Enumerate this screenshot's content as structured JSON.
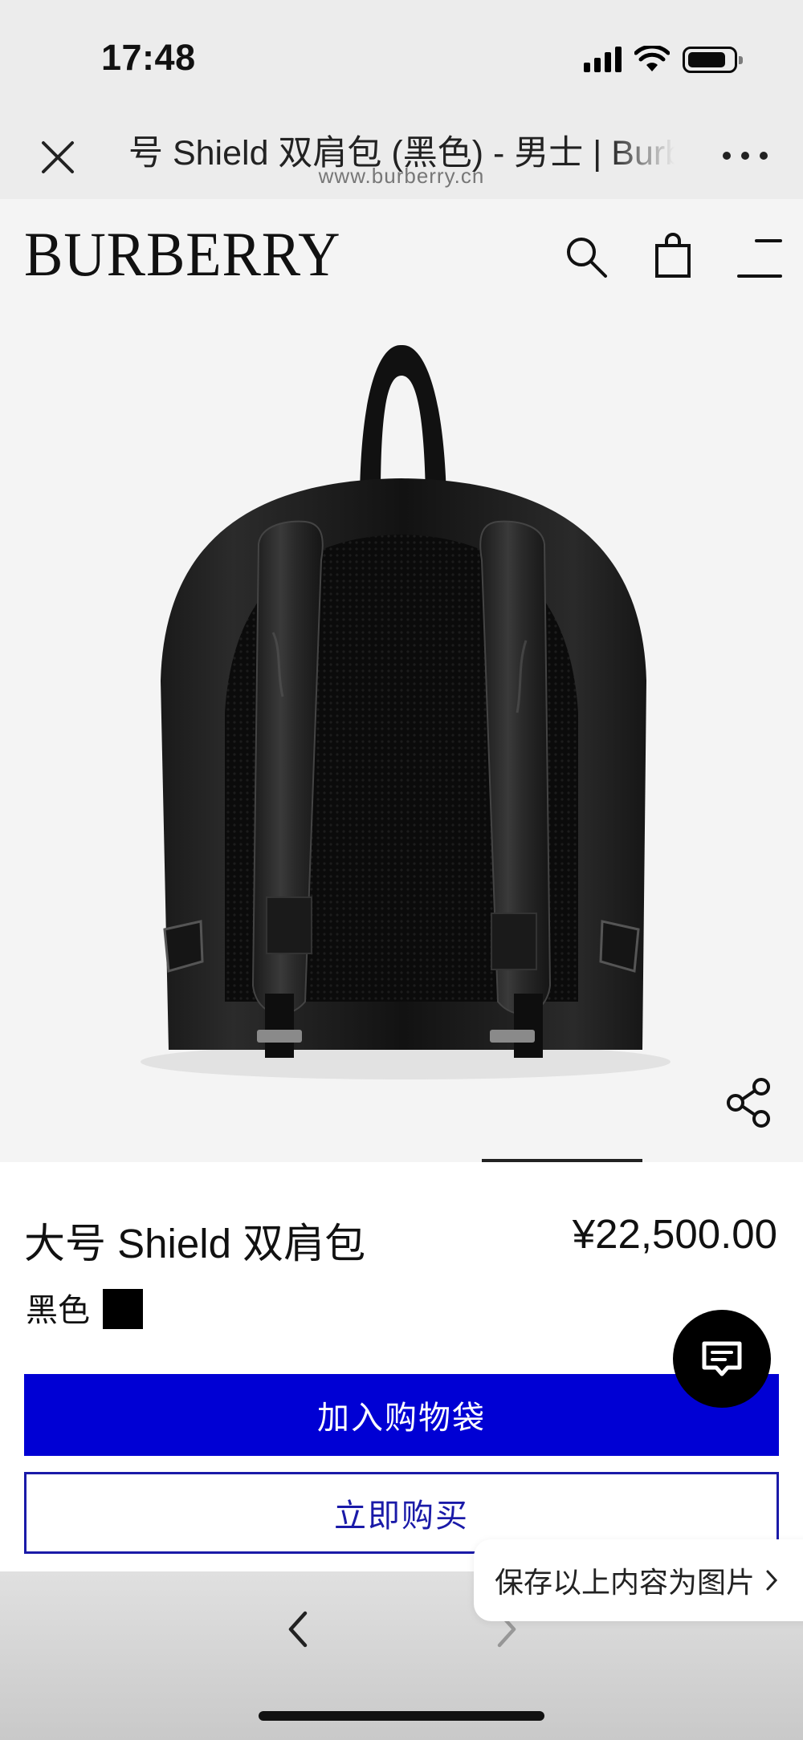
{
  "status_bar": {
    "time": "17:48"
  },
  "browser": {
    "page_title": "号 Shield 双肩包 (黑色) - 男士 | Burberry",
    "url": "www.burberry.cn"
  },
  "site": {
    "logo_text": "BURBERRY"
  },
  "product": {
    "name": "大号 Shield 双肩包",
    "price": "¥22,500.00",
    "color_label": "黑色",
    "color_swatch_hex": "#000000"
  },
  "actions": {
    "add_to_bag_label": "加入购物袋",
    "buy_now_label": "立即购买"
  },
  "overlay": {
    "save_as_image_label": "保存以上内容为图片"
  },
  "colors": {
    "primary_blue": "#0000d4",
    "outline_blue": "#1a1aa8"
  },
  "icons": {
    "close": "close-icon",
    "more": "more-icon",
    "search": "search-icon",
    "bag": "shopping-bag-icon",
    "menu": "menu-icon",
    "share": "share-icon",
    "chat": "chat-icon",
    "back": "chevron-left-icon",
    "forward": "chevron-right-icon"
  }
}
